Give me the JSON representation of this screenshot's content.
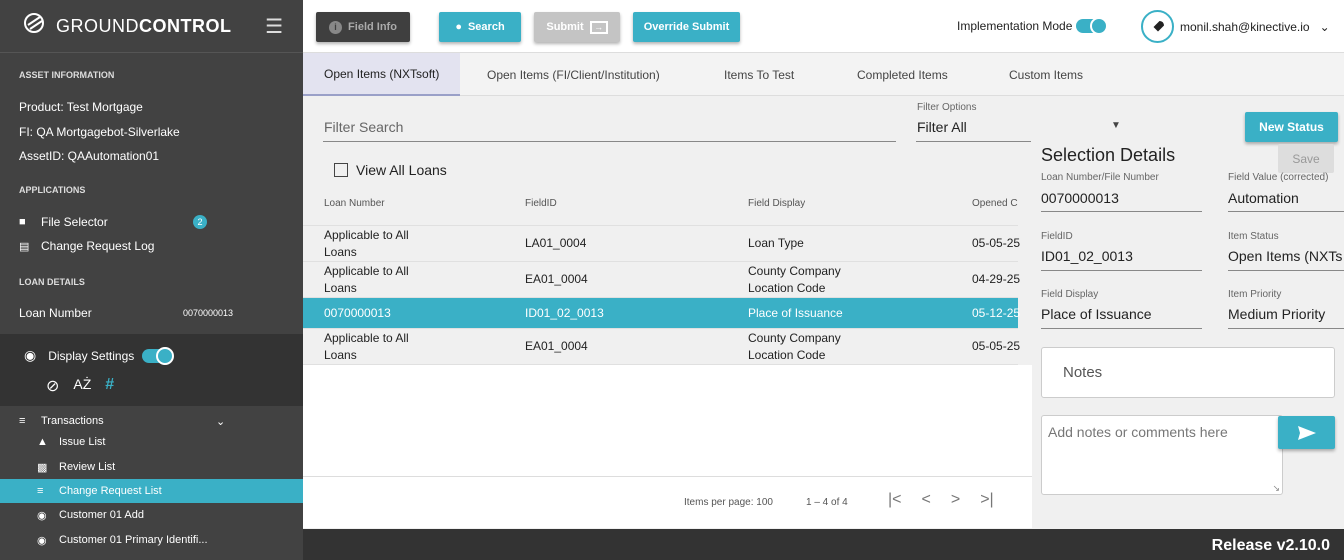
{
  "brand": {
    "prefix": "GROUND",
    "bold": "CONTROL"
  },
  "sidebar": {
    "asset_info_head": "ASSET INFORMATION",
    "product": "Product:  Test Mortgage",
    "fi": "FI:  QA Mortgagebot-Silverlake",
    "asset_id": "AssetID:  QAAutomation01",
    "applications_head": "APPLICATIONS",
    "file_selector": "File Selector",
    "file_selector_badge": "2",
    "change_request_log": "Change Request Log",
    "loan_details_head": "LOAN DETAILS",
    "loan_number_label": "Loan Number",
    "loan_number_value": "0070000013",
    "display_settings": "Display Settings",
    "transactions": "Transactions",
    "items": [
      {
        "icon": "warning-icon",
        "label": "Issue List"
      },
      {
        "icon": "review-icon",
        "label": "Review List"
      },
      {
        "icon": "change-request-icon",
        "label": "Change Request List"
      },
      {
        "icon": "eye-icon",
        "label": "Customer 01 Add"
      },
      {
        "icon": "eye-icon",
        "label": "Customer 01 Primary Identifi..."
      }
    ]
  },
  "toolbar": {
    "field_info": "Field Info",
    "search": "Search",
    "submit": "Submit",
    "override_submit": "Override Submit",
    "implementation_mode": "Implementation Mode",
    "user": "monil.shah@kinective.io"
  },
  "tabs": [
    "Open Items (NXTsoft)",
    "Open Items (FI/Client/Institution)",
    "Items To Test",
    "Completed Items",
    "Custom Items"
  ],
  "filter": {
    "search_placeholder": "Filter Search",
    "options_label": "Filter Options",
    "options_value": "Filter All",
    "view_all_loans": "View All Loans",
    "new_status": "New Status"
  },
  "table": {
    "headers": [
      "Loan Number",
      "FieldID",
      "Field Display",
      "Opened C"
    ],
    "rows": [
      {
        "loan_1": "Applicable to All",
        "loan_2": "Loans",
        "field_id": "LA01_0004",
        "display_1": "Loan Type",
        "display_2": "",
        "opened": "05-05-25"
      },
      {
        "loan_1": "Applicable to All",
        "loan_2": "Loans",
        "field_id": "EA01_0004",
        "display_1": "County Company",
        "display_2": "Location Code",
        "opened": "04-29-25"
      },
      {
        "loan_1": "0070000013",
        "loan_2": "",
        "field_id": "ID01_02_0013",
        "display_1": "Place of Issuance",
        "display_2": "",
        "opened": "05-12-25"
      },
      {
        "loan_1": "Applicable to All",
        "loan_2": "Loans",
        "field_id": "EA01_0004",
        "display_1": "County Company",
        "display_2": "Location Code",
        "opened": "05-05-25"
      }
    ]
  },
  "pager": {
    "items_per_page": "Items per page: 100",
    "range": "1 – 4 of 4"
  },
  "details": {
    "title": "Selection Details",
    "save": "Save",
    "loan_label": "Loan Number/File Number",
    "loan_value": "0070000013",
    "field_value_label": "Field Value (corrected)",
    "field_value": "Automation",
    "field_id_label": "FieldID",
    "field_id_value": "ID01_02_0013",
    "status_label": "Item Status",
    "status_value": "Open Items (NXTs",
    "display_label": "Field Display",
    "display_value": "Place of Issuance",
    "priority_label": "Item Priority",
    "priority_value": "Medium Priority",
    "notes_title": "Notes",
    "notes_placeholder": "Add notes or comments here"
  },
  "footer": {
    "release": "Release v2.10.0"
  },
  "colors": {
    "accent": "#3ab0c6",
    "sidebar": "#424242",
    "dark": "#333333"
  }
}
